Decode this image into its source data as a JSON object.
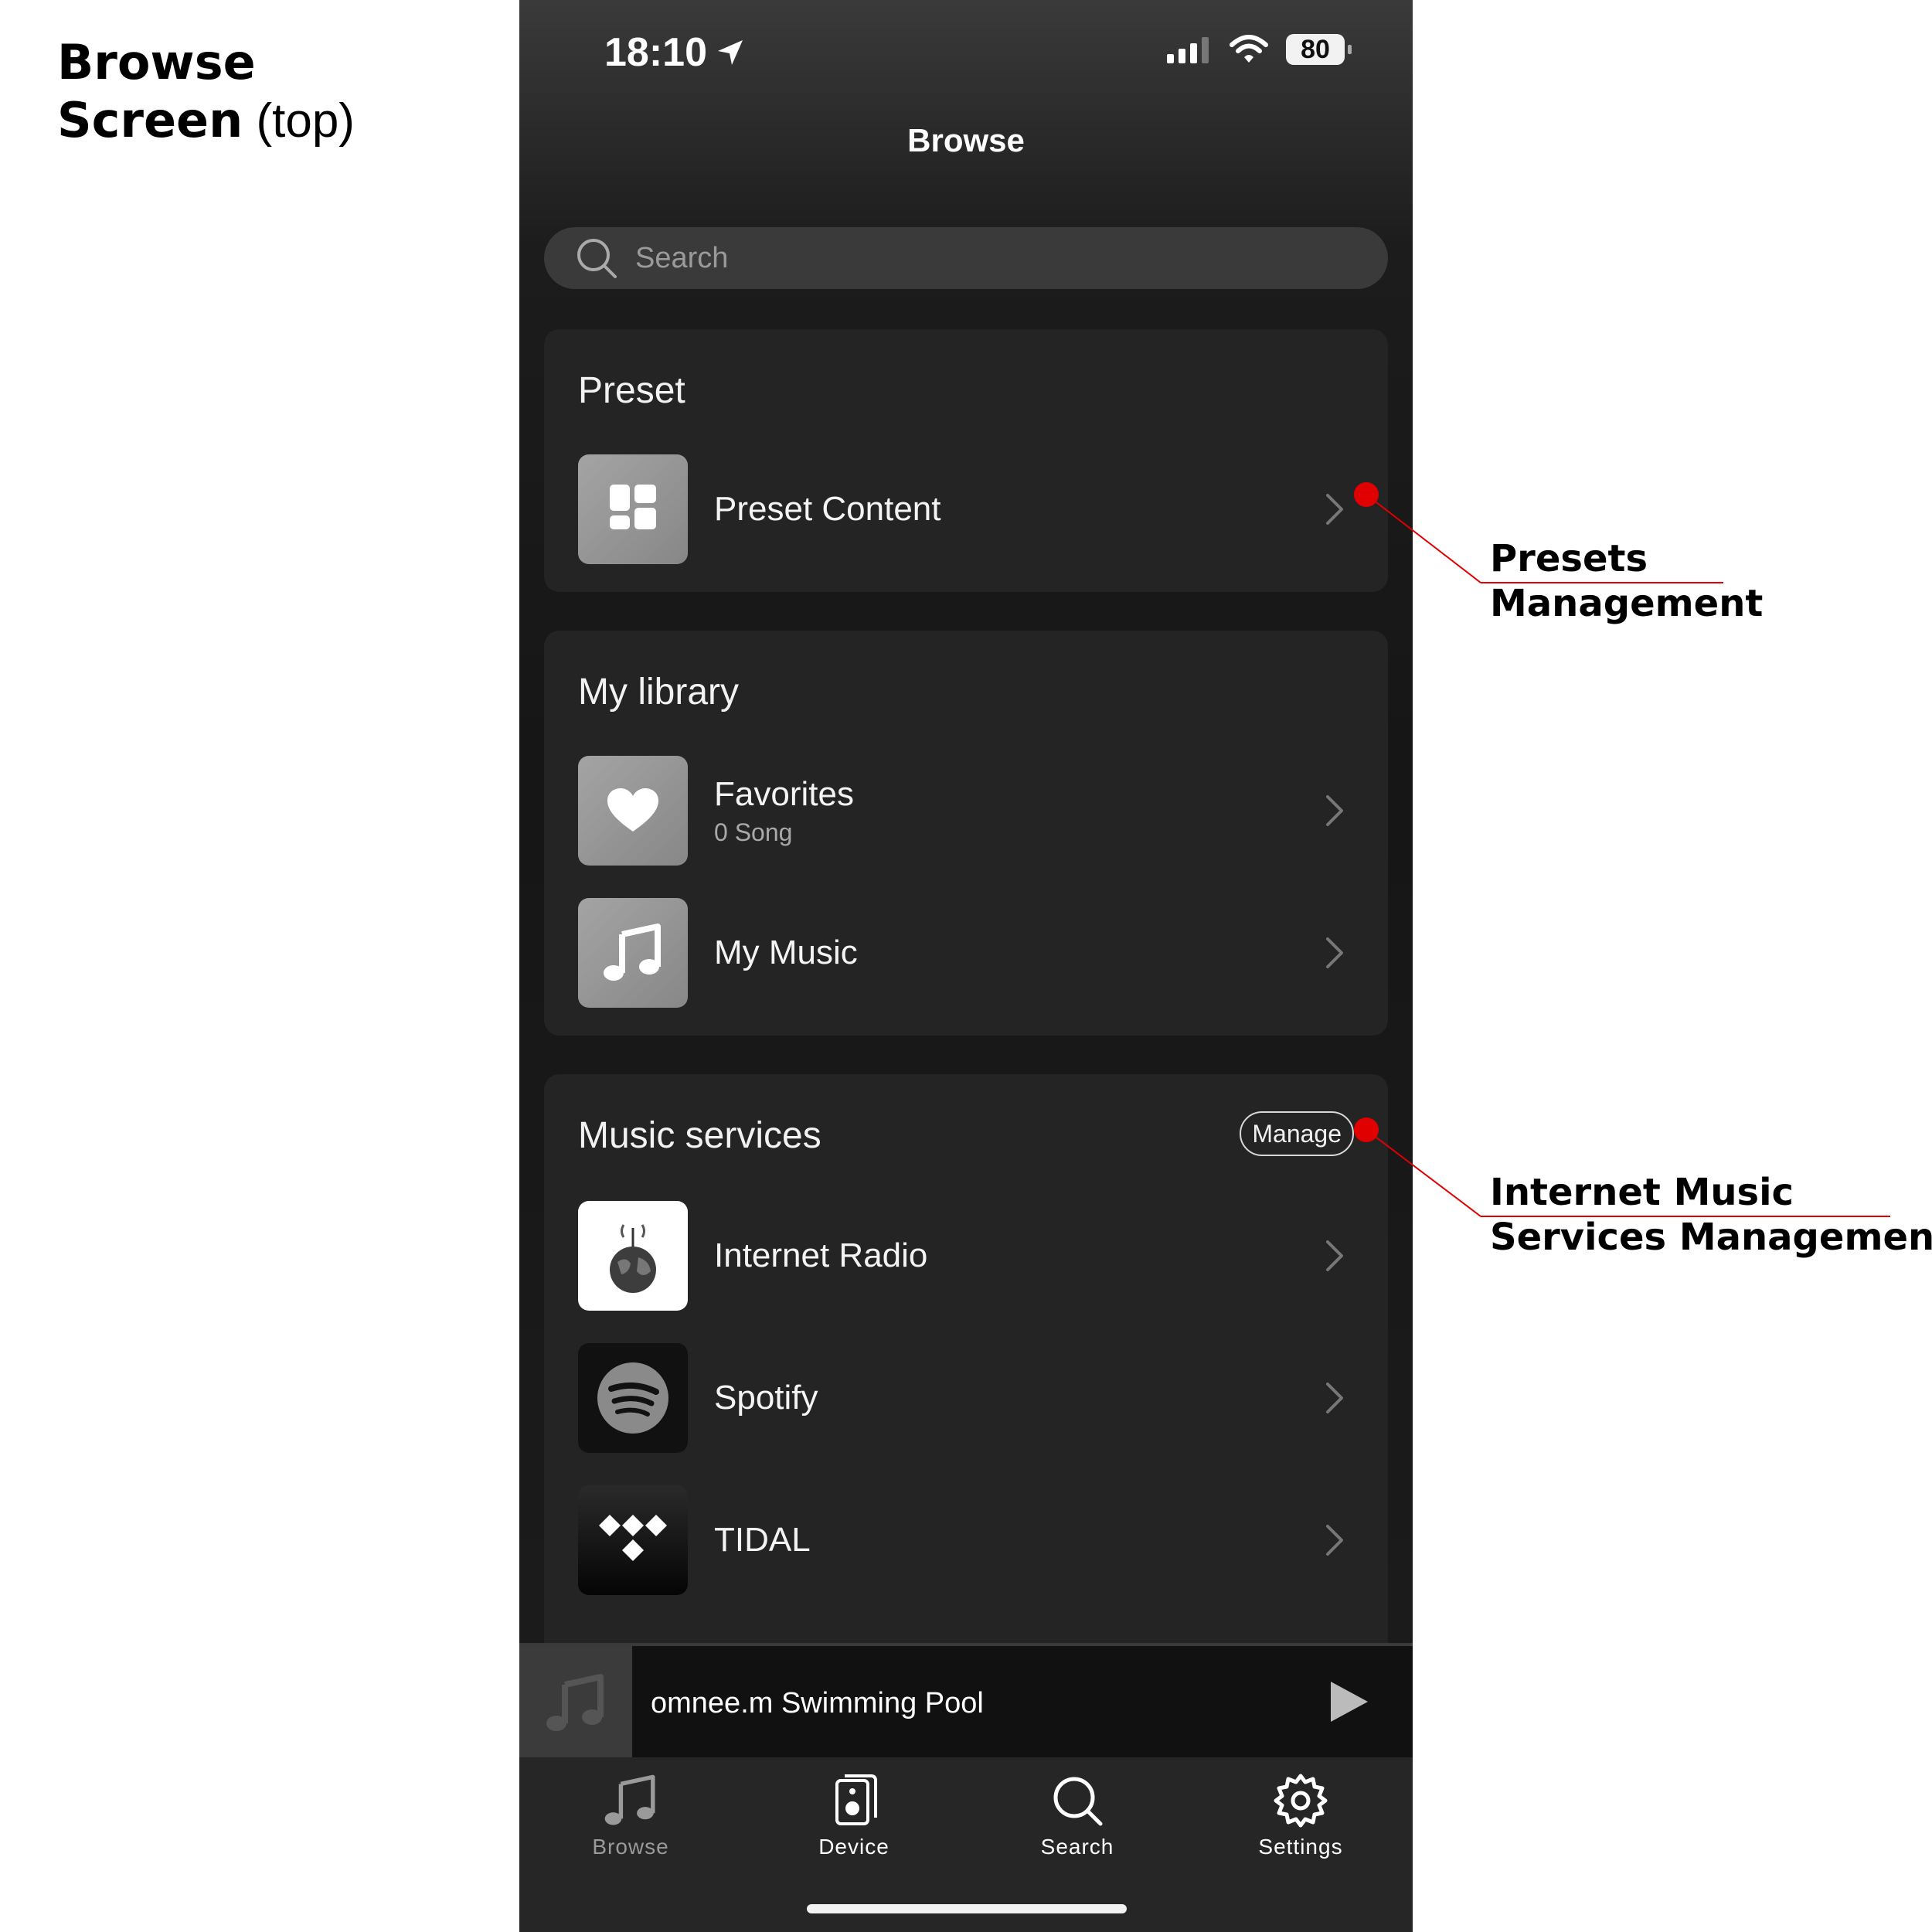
{
  "caption": {
    "line1": "Browse",
    "line2_bold": "Screen",
    "line2_rest": "(top)"
  },
  "status_bar": {
    "time": "18:10",
    "battery": "80"
  },
  "header": {
    "title": "Browse"
  },
  "search": {
    "placeholder": "Search"
  },
  "preset": {
    "title": "Preset",
    "items": [
      {
        "label": "Preset Content",
        "icon": "grid-icon"
      }
    ]
  },
  "library": {
    "title": "My library",
    "items": [
      {
        "label": "Favorites",
        "sub": "0 Song",
        "icon": "heart-icon"
      },
      {
        "label": "My Music",
        "icon": "music-note-icon"
      }
    ]
  },
  "services": {
    "title": "Music services",
    "manage_label": "Manage",
    "items": [
      {
        "label": "Internet Radio",
        "icon": "globe-radio-icon"
      },
      {
        "label": "Spotify",
        "icon": "spotify-icon"
      },
      {
        "label": "TIDAL",
        "icon": "tidal-icon"
      }
    ]
  },
  "mini_player": {
    "title": "omnee.m Swimming Pool"
  },
  "tabbar": {
    "tabs": [
      {
        "label": "Browse",
        "icon": "music-note-icon",
        "active": false
      },
      {
        "label": "Device",
        "icon": "speaker-icon",
        "active": true
      },
      {
        "label": "Search",
        "icon": "search-icon",
        "active": true
      },
      {
        "label": "Settings",
        "icon": "gear-icon",
        "active": true
      }
    ]
  },
  "annotations": {
    "presets": {
      "line1": "Presets",
      "line2": "Management"
    },
    "services": {
      "line1": "Internet Music",
      "line2": "Services Management"
    }
  },
  "colors": {
    "annotation": "#e00000",
    "background": "#161616",
    "card": "#242424"
  }
}
